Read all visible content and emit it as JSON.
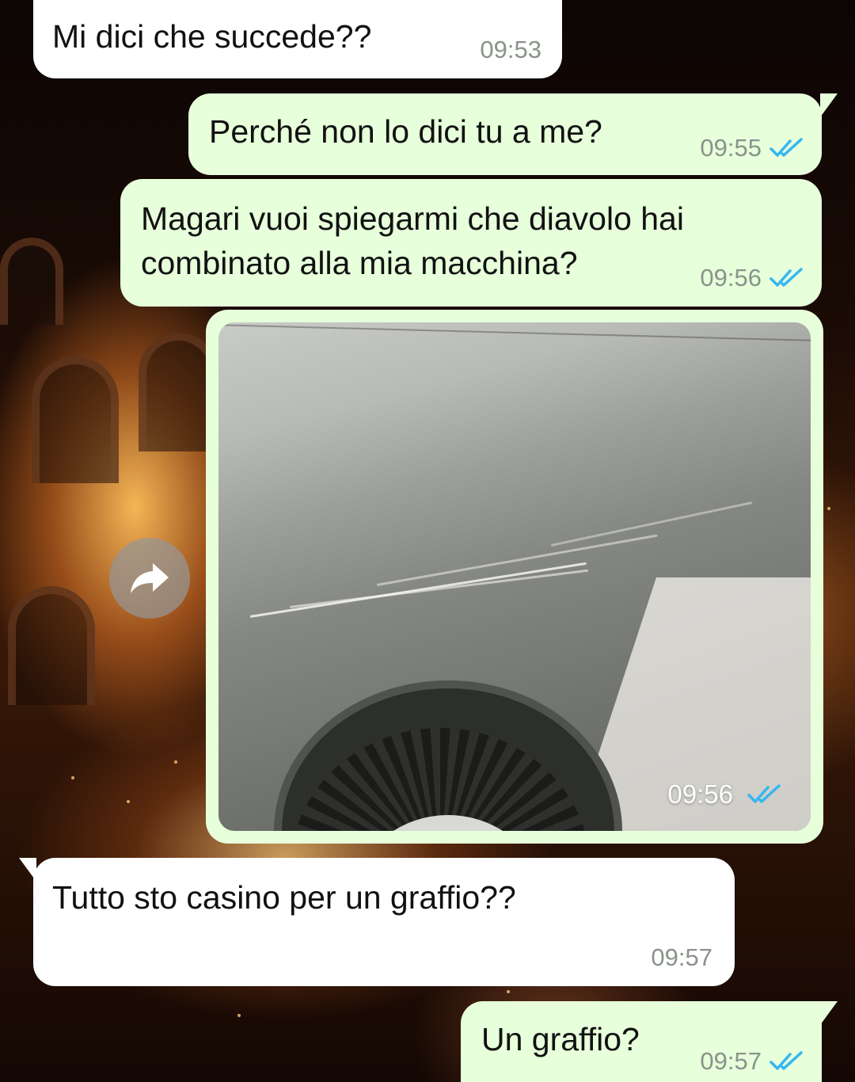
{
  "conversation": {
    "messages": [
      {
        "direction": "incoming",
        "text": "Mi dici che succede??",
        "time": "09:53"
      },
      {
        "direction": "outgoing",
        "text": "Perché non lo dici tu a me?",
        "time": "09:55",
        "status": "read"
      },
      {
        "direction": "outgoing",
        "text_lines": [
          "Magari vuoi spiegarmi che diavolo hai",
          "combinato alla mia macchina?"
        ],
        "time": "09:56",
        "status": "read"
      },
      {
        "direction": "outgoing",
        "type": "photo",
        "subject": "scratched car door",
        "time": "09:56",
        "status": "read"
      },
      {
        "direction": "incoming",
        "text": "Tutto sto casino per un graffio??",
        "time": "09:57"
      },
      {
        "direction": "outgoing",
        "text": "Un graffio?",
        "time": "09:57",
        "status": "read"
      }
    ]
  },
  "icons": {
    "read_receipt": "double-check-icon",
    "forward": "forward-arrow-icon"
  },
  "colors": {
    "incoming_bubble": "#ffffff",
    "outgoing_bubble": "#e7ffdb",
    "read_tick": "#34b7f1",
    "timestamp": "#8a9389"
  }
}
